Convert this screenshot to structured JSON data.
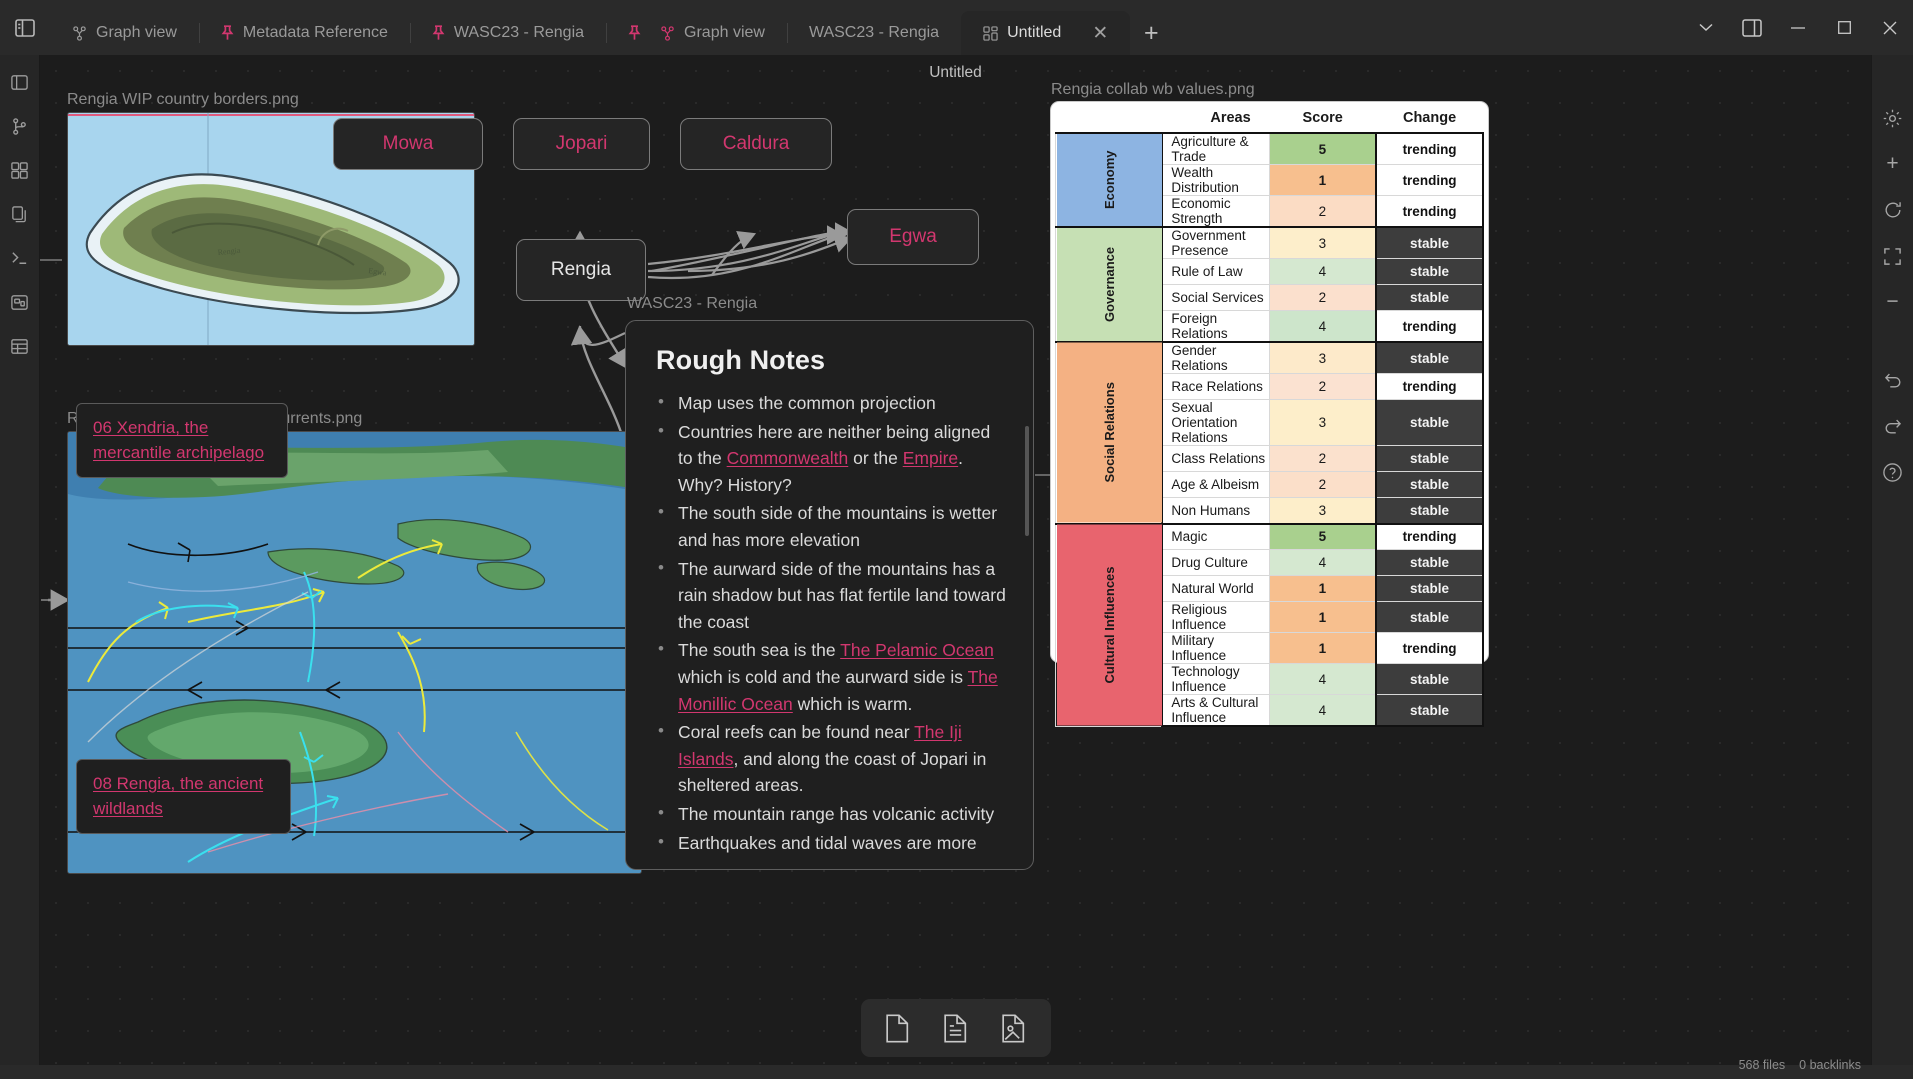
{
  "window": {
    "title": "Untitled",
    "minimize": "—",
    "maximize": "□",
    "close": "✕"
  },
  "tabs": [
    {
      "label": "Graph view",
      "icon": "graph-icon",
      "pinned": false,
      "active": false
    },
    {
      "label": "Metadata Reference",
      "icon": "pin-icon",
      "pinned": true,
      "active": false
    },
    {
      "label": "WASC23 - Rengia",
      "icon": "pin-icon",
      "pinned": true,
      "active": false
    },
    {
      "label": "Graph view",
      "icon": "graph-icon",
      "pinned": false,
      "active": false
    },
    {
      "label": "WASC23 - Rengia",
      "icon": "none",
      "pinned": false,
      "active": false
    },
    {
      "label": "Untitled",
      "icon": "canvas-icon",
      "pinned": false,
      "active": true
    }
  ],
  "tab_controls": {
    "close": "✕",
    "new_tab": "+",
    "tab_list": "chevron-down-icon",
    "right_sidebar": "panel-right-icon"
  },
  "canvas": {
    "header_title": "Untitled",
    "cards": {
      "map_top_label": "Rengia WIP country borders.png",
      "map_bottom_label": "Rengia & Xendria winds and currents.png",
      "table_label": "Rengia collab wb values.png",
      "rengia_note_label": "WASC23 - Rengia"
    },
    "nodes": [
      {
        "id": "mowa",
        "label": "Mowa",
        "type": "link"
      },
      {
        "id": "jopari",
        "label": "Jopari",
        "type": "link"
      },
      {
        "id": "caldura",
        "label": "Caldura",
        "type": "link"
      },
      {
        "id": "egwa",
        "label": "Egwa",
        "type": "link"
      },
      {
        "id": "rengia",
        "label": "Rengia",
        "type": "plain"
      }
    ],
    "map_labels": [
      {
        "id": "xendria",
        "text": "06 Xendria, the mercantile archipelago"
      },
      {
        "id": "rengia-wildlands",
        "text": "08 Rengia, the ancient wildlands"
      }
    ]
  },
  "notes": {
    "title": "Rough Notes",
    "items": [
      {
        "parts": [
          {
            "t": "Map uses the common projection"
          }
        ]
      },
      {
        "parts": [
          {
            "t": "Countries here are neither being aligned to the "
          },
          {
            "t": "Commonwealth",
            "link": true
          },
          {
            "t": " or the "
          },
          {
            "t": "Empire",
            "link": true
          },
          {
            "t": ". Why? History?"
          }
        ]
      },
      {
        "parts": [
          {
            "t": "The south side of the mountains is wetter and has more elevation"
          }
        ]
      },
      {
        "parts": [
          {
            "t": "The aurward side of the mountains has a rain shadow but has flat fertile land toward the coast"
          }
        ]
      },
      {
        "parts": [
          {
            "t": "The south sea is the "
          },
          {
            "t": "The Pelamic Ocean",
            "link": true
          },
          {
            "t": " which is cold and the aurward side is "
          },
          {
            "t": "The Monillic Ocean",
            "link": true
          },
          {
            "t": " which is warm."
          }
        ]
      },
      {
        "parts": [
          {
            "t": "Coral reefs can be found near "
          },
          {
            "t": "The Iji Islands",
            "link": true
          },
          {
            "t": ", and along the coast of Jopari in sheltered areas."
          }
        ]
      },
      {
        "parts": [
          {
            "t": "The mountain range has volcanic activity"
          }
        ]
      },
      {
        "parts": [
          {
            "t": "Earthquakes and tidal waves are more"
          }
        ]
      }
    ]
  },
  "wb_table": {
    "headers": {
      "areas": "Areas",
      "score": "Score",
      "change": "Change"
    },
    "groups": [
      {
        "name": "Economy",
        "color": "#8db4e2",
        "rows": [
          {
            "area": "Agriculture & Trade",
            "score": "5",
            "score_color": "#a9d08e",
            "bold": true,
            "change": "trending"
          },
          {
            "area": "Wealth Distribution",
            "score": "1",
            "score_color": "#f7bf8e",
            "bold": true,
            "change": "trending"
          },
          {
            "area": "Economic Strength",
            "score": "2",
            "score_color": "#fbdcc4",
            "bold": false,
            "change": "trending"
          }
        ]
      },
      {
        "name": "Governance",
        "color": "#c6e0b4",
        "rows": [
          {
            "area": "Government Presence",
            "score": "3",
            "score_color": "#fdeecb",
            "bold": false,
            "change": "stable"
          },
          {
            "area": "Rule of Law",
            "score": "4",
            "score_color": "#d5e8d0",
            "bold": false,
            "change": "stable"
          },
          {
            "area": "Social Services",
            "score": "2",
            "score_color": "#fbe0cd",
            "bold": false,
            "change": "stable"
          },
          {
            "area": "Foreign Relations",
            "score": "4",
            "score_color": "#cde5cb",
            "bold": false,
            "change": "trending"
          }
        ]
      },
      {
        "name": "Social Relations",
        "color": "#f4b183",
        "rows": [
          {
            "area": "Gender Relations",
            "score": "3",
            "score_color": "#fdeaca",
            "bold": false,
            "change": "stable"
          },
          {
            "area": "Race Relations",
            "score": "2",
            "score_color": "#fbe2d1",
            "bold": false,
            "change": "trending"
          },
          {
            "area": "Sexual Orientation Relations",
            "score": "3",
            "score_color": "#fdeeca",
            "bold": false,
            "change": "stable"
          },
          {
            "area": "Class Relations",
            "score": "2",
            "score_color": "#fbe1cd",
            "bold": false,
            "change": "stable"
          },
          {
            "area": "Age & Albeism",
            "score": "2",
            "score_color": "#fbdfc9",
            "bold": false,
            "change": "stable"
          },
          {
            "area": "Non Humans",
            "score": "3",
            "score_color": "#fdeeca",
            "bold": false,
            "change": "stable"
          }
        ]
      },
      {
        "name": "Cultural Influences",
        "color": "#e8646e",
        "rows": [
          {
            "area": "Magic",
            "score": "5",
            "score_color": "#a9d08e",
            "bold": true,
            "change": "trending"
          },
          {
            "area": "Drug Culture",
            "score": "4",
            "score_color": "#d5e8d0",
            "bold": false,
            "change": "stable"
          },
          {
            "area": "Natural World",
            "score": "1",
            "score_color": "#f7bf8e",
            "bold": true,
            "change": "stable"
          },
          {
            "area": "Religious Influence",
            "score": "1",
            "score_color": "#f7bf8e",
            "bold": true,
            "change": "stable"
          },
          {
            "area": "Military Influence",
            "score": "1",
            "score_color": "#f7bf8e",
            "bold": true,
            "change": "trending"
          },
          {
            "area": "Technology Influence",
            "score": "4",
            "score_color": "#d5e8d0",
            "bold": false,
            "change": "stable"
          },
          {
            "area": "Arts & Cultural Influence",
            "score": "4",
            "score_color": "#d5e8d0",
            "bold": false,
            "change": "stable"
          }
        ]
      }
    ]
  },
  "bottom_toolbar": [
    {
      "id": "add-card",
      "icon": "note-blank-icon"
    },
    {
      "id": "add-note",
      "icon": "note-text-icon"
    },
    {
      "id": "add-media",
      "icon": "image-file-icon"
    }
  ],
  "statusbar": {
    "files": "568 files",
    "backlinks": "0 backlinks"
  },
  "right_rail": [
    {
      "id": "settings",
      "icon": "gear-icon",
      "glyph": "⚙"
    },
    {
      "id": "zoom-in",
      "icon": "plus-icon",
      "glyph": "+"
    },
    {
      "id": "reset-zoom",
      "icon": "refresh-icon",
      "glyph": "⟳"
    },
    {
      "id": "zoom-fit",
      "icon": "expand-icon",
      "glyph": "⛶"
    },
    {
      "id": "zoom-out",
      "icon": "minus-icon",
      "glyph": "−"
    },
    {
      "id": "undo",
      "icon": "undo-icon",
      "glyph": "↶"
    },
    {
      "id": "redo",
      "icon": "redo-icon",
      "glyph": "↷"
    },
    {
      "id": "help",
      "icon": "help-icon",
      "glyph": "?"
    }
  ],
  "left_rail": [
    {
      "id": "files",
      "icon": "folder-icon"
    },
    {
      "id": "git",
      "icon": "git-branch-icon"
    },
    {
      "id": "plugins",
      "icon": "grid-icon"
    },
    {
      "id": "copy",
      "icon": "copy-icon"
    },
    {
      "id": "terminal",
      "icon": "terminal-icon"
    },
    {
      "id": "canvas",
      "icon": "canvas-icon"
    },
    {
      "id": "table",
      "icon": "table-icon"
    }
  ],
  "colors": {
    "accent": "#d2376f",
    "bg": "#1c1c1c",
    "chrome": "#2a2a2a"
  }
}
